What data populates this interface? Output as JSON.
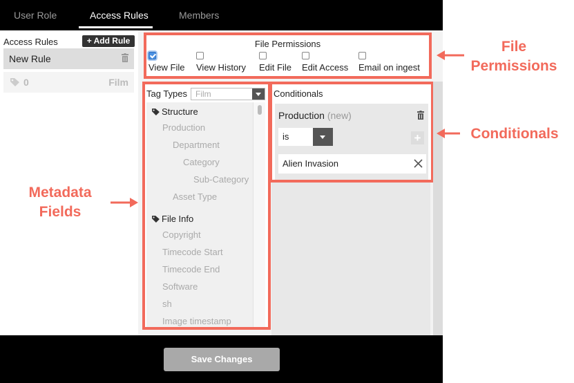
{
  "tabs": [
    {
      "label": "User Role"
    },
    {
      "label": "Access Rules"
    },
    {
      "label": "Members"
    }
  ],
  "sidebar": {
    "title": "Access Rules",
    "add_rule_label": "+ Add Rule",
    "rule": {
      "name": "New Rule",
      "count": "0",
      "type": "Film"
    }
  },
  "permissions": {
    "title": "File Permissions",
    "items": [
      {
        "label": "View File",
        "checked": true
      },
      {
        "label": "View History",
        "checked": false
      },
      {
        "label": "Edit File",
        "checked": false
      },
      {
        "label": "Edit Access",
        "checked": false
      },
      {
        "label": "Email on ingest",
        "checked": false
      }
    ]
  },
  "metadata": {
    "header_label": "Tag Types",
    "selected_type": "Film",
    "items": [
      {
        "label": "Structure",
        "group": true
      },
      {
        "label": "Production"
      },
      {
        "label": "Department"
      },
      {
        "label": "Category"
      },
      {
        "label": "Sub-Category"
      },
      {
        "label": "Asset Type"
      },
      {
        "label": "File Info",
        "group": true
      },
      {
        "label": "Copyright"
      },
      {
        "label": "Timecode Start"
      },
      {
        "label": "Timecode End"
      },
      {
        "label": "Software"
      },
      {
        "label": "sh"
      },
      {
        "label": "Image timestamp"
      }
    ]
  },
  "conditionals": {
    "title": "Conditionals",
    "field_name": "Production",
    "field_badge": "(new)",
    "operator": "is",
    "value": "Alien Invasion",
    "plus_label": "+"
  },
  "footer": {
    "save_label": "Save Changes"
  },
  "callouts": {
    "file_permissions": "File Permissions",
    "conditionals": "Conditionals",
    "metadata_fields": "Metadata Fields"
  },
  "colors": {
    "annotation": "#f26a5b",
    "checked": "#4a90e2"
  }
}
